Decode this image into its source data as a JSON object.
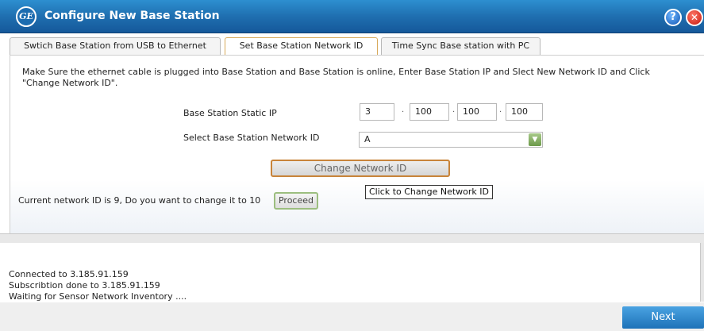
{
  "window": {
    "title": "Configure New Base Station",
    "help_icon": "question-circle",
    "close_icon": "close-x",
    "logo_icon": "ge-logo",
    "logo_text": "GE"
  },
  "tabs": [
    {
      "label": "Swtich Base Station from USB to Ethernet",
      "active": false
    },
    {
      "label": "Set Base Station Network ID",
      "active": true
    },
    {
      "label": "Time Sync Base station with PC",
      "active": false
    }
  ],
  "main": {
    "instruction": "Make Sure the ethernet cable is plugged into Base Station and Base Station is online, Enter Base Station IP and Slect New Network ID and Click \"Change Network ID\".",
    "ip_label": "Base Station Static IP",
    "ip": [
      "3",
      "100",
      "100",
      "100"
    ],
    "network_id_label": "Select Base Station Network ID",
    "network_id_value": "A",
    "change_button": "Change Network ID",
    "tooltip": "Click to Change Network ID",
    "current_text": "Current network ID is 9, Do you want to change it to 10",
    "proceed_button": "Proceed"
  },
  "log": {
    "lines": [
      "Connected to 3.185.91.159",
      "Subscribtion done to 3.185.91.159",
      "Waiting for Sensor Network Inventory  ...."
    ]
  },
  "footer": {
    "next_button": "Next"
  },
  "colors": {
    "titlebar": "#1f6fb0",
    "active_tab_border": "#d8a95a",
    "change_button_border": "#c8843a",
    "next_button": "#1e72b8"
  }
}
